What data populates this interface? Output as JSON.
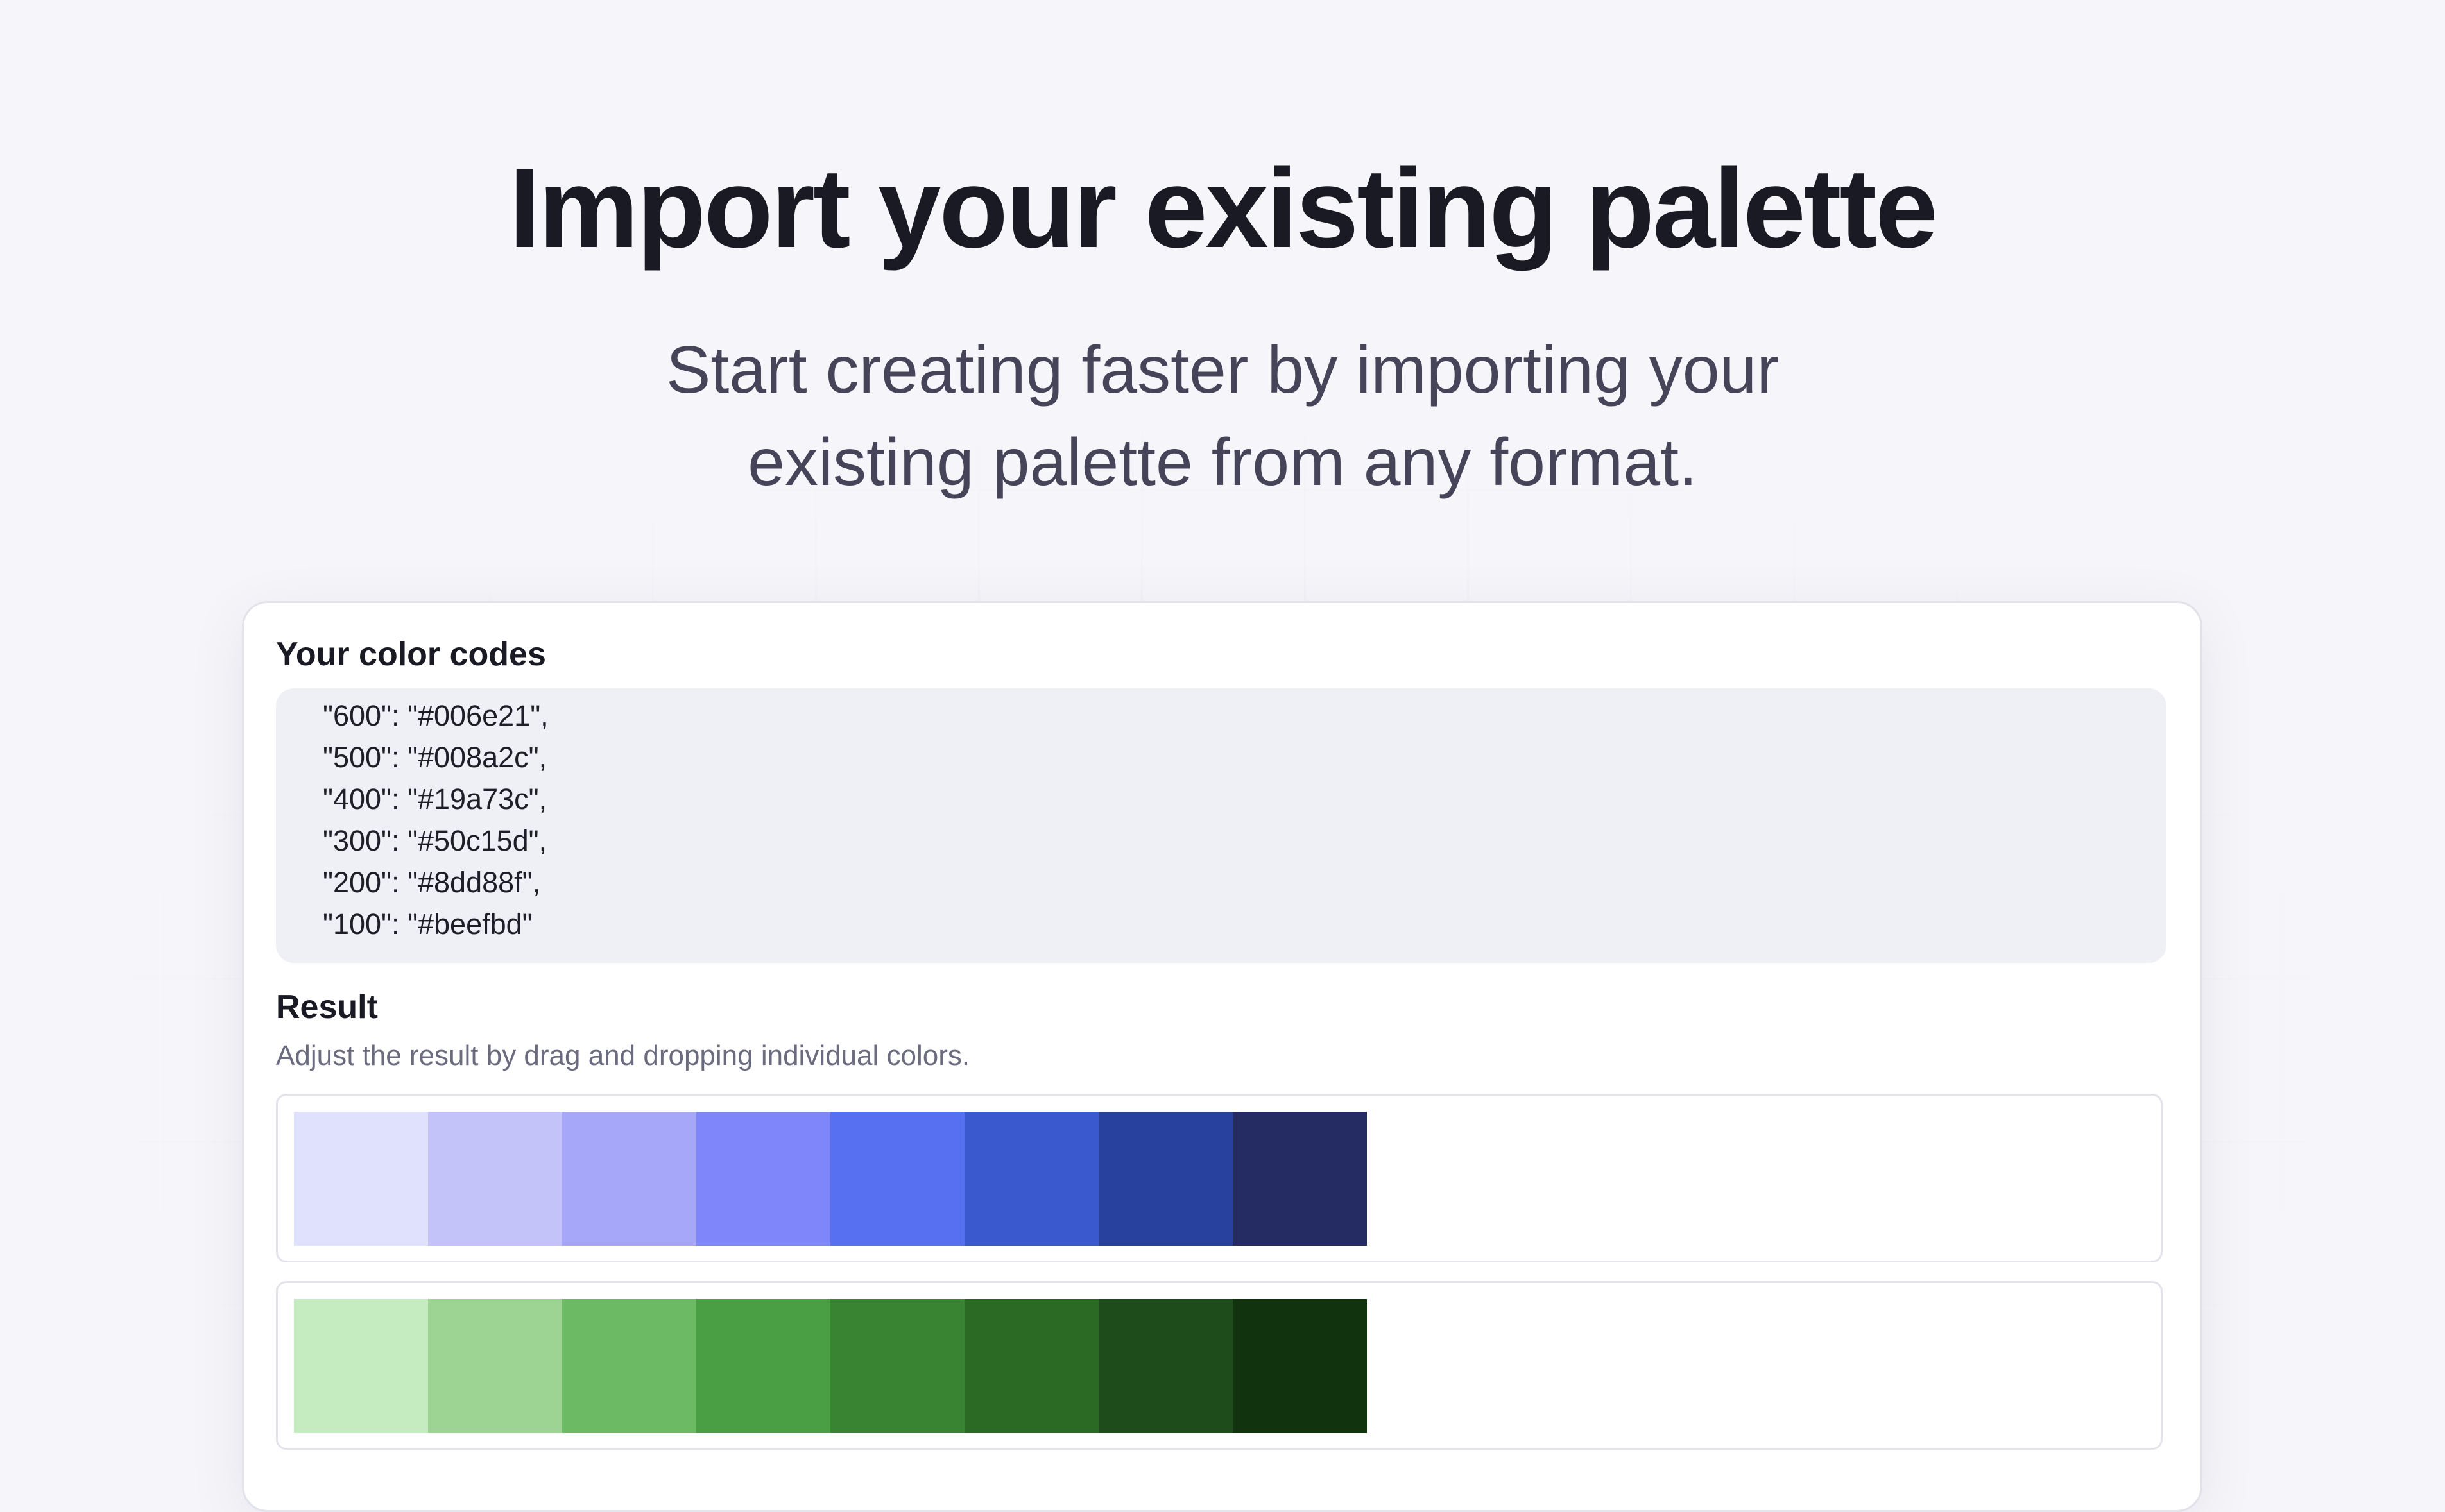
{
  "hero": {
    "title": "Import your existing palette",
    "subtitle": "Start creating faster by importing your existing palette from any format."
  },
  "codes": {
    "label": "Your color codes",
    "lines": [
      "\"600\": \"#006e21\",",
      "\"500\": \"#008a2c\",",
      "\"400\": \"#19a73c\",",
      "\"300\": \"#50c15d\",",
      "\"200\": \"#8dd88f\",",
      "\"100\": \"#beefbd\""
    ]
  },
  "result": {
    "label": "Result",
    "description": "Adjust the result by drag and dropping individual colors.",
    "palettes": [
      {
        "colors": [
          "#e0e1fc",
          "#c3c3f9",
          "#a6a7f8",
          "#7f86f9",
          "#5770f2",
          "#3b59cf",
          "#28419e",
          "#252b63"
        ]
      },
      {
        "colors": [
          "#c5ebc1",
          "#9dd493",
          "#6cbb64",
          "#4a9e43",
          "#388433",
          "#2a6a25",
          "#1e4c1b",
          "#11330e"
        ]
      }
    ]
  }
}
